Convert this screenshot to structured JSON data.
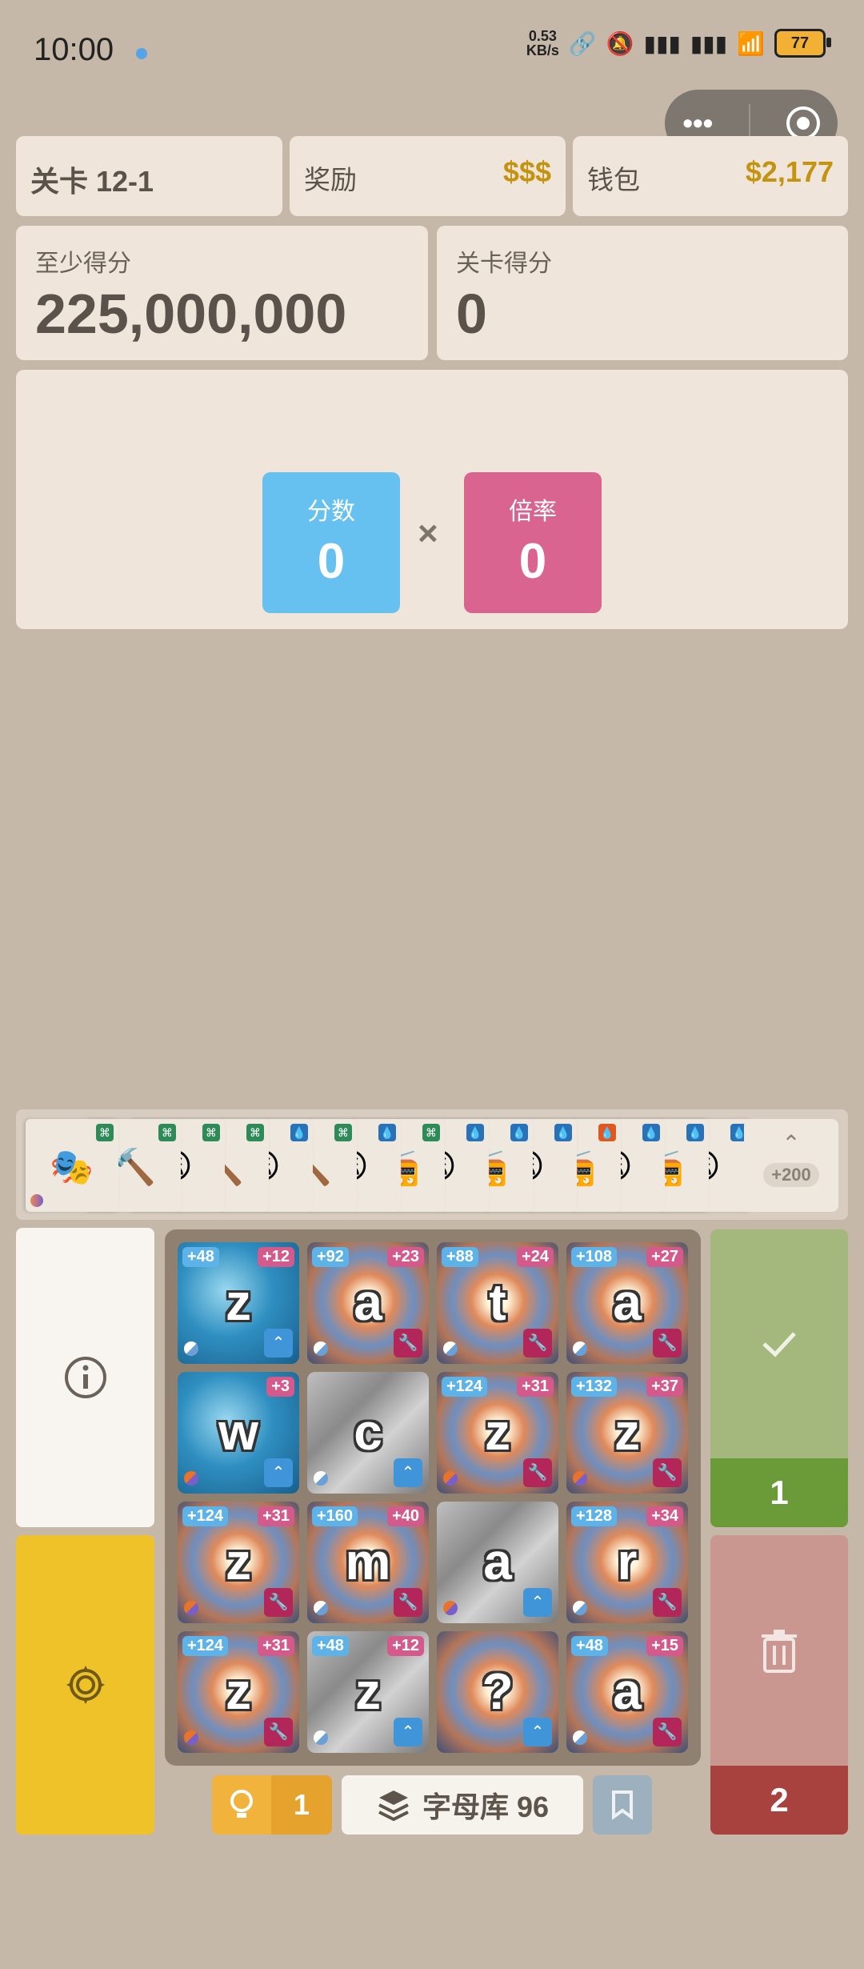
{
  "status": {
    "time": "10:00",
    "net_speed": "0.53",
    "net_unit": "KB/s",
    "battery": "77"
  },
  "header": {
    "level_label": "关卡 12-1",
    "reward_label": "奖励",
    "reward_value": "$$$",
    "wallet_label": "钱包",
    "wallet_value": "$2,177",
    "need_label": "至少得分",
    "need_value": "225,000,000",
    "level_score_label": "关卡得分",
    "level_score_value": "0"
  },
  "scoring": {
    "score_label": "分数",
    "score_value": "0",
    "times": "×",
    "mult_label": "倍率",
    "mult_value": "0"
  },
  "tray": {
    "upgrade_badge": "+200"
  },
  "tiles": [
    {
      "letter": "z",
      "left": "+48",
      "right": "+12",
      "bg": "water",
      "effect": "up",
      "dot": "white"
    },
    {
      "letter": "a",
      "left": "+92",
      "right": "+23",
      "bg": "burst",
      "effect": "tool",
      "dot": "white"
    },
    {
      "letter": "t",
      "left": "+88",
      "right": "+24",
      "bg": "burst",
      "effect": "tool",
      "dot": "white"
    },
    {
      "letter": "a",
      "left": "+108",
      "right": "+27",
      "bg": "burst",
      "effect": "tool",
      "dot": "white"
    },
    {
      "letter": "w",
      "left": "",
      "right": "+3",
      "bg": "water",
      "effect": "up",
      "dot": "multi"
    },
    {
      "letter": "c",
      "left": "",
      "right": "",
      "bg": "steel",
      "effect": "up",
      "dot": "white"
    },
    {
      "letter": "z",
      "left": "+124",
      "right": "+31",
      "bg": "burst",
      "effect": "tool",
      "dot": "multi"
    },
    {
      "letter": "z",
      "left": "+132",
      "right": "+37",
      "bg": "burst",
      "effect": "tool",
      "dot": "multi"
    },
    {
      "letter": "z",
      "left": "+124",
      "right": "+31",
      "bg": "burst",
      "effect": "tool",
      "dot": "multi"
    },
    {
      "letter": "m",
      "left": "+160",
      "right": "+40",
      "bg": "burst",
      "effect": "tool",
      "dot": "white"
    },
    {
      "letter": "a",
      "left": "",
      "right": "",
      "bg": "steel",
      "effect": "up",
      "dot": "multi"
    },
    {
      "letter": "r",
      "left": "+128",
      "right": "+34",
      "bg": "burst",
      "effect": "tool",
      "dot": "white"
    },
    {
      "letter": "z",
      "left": "+124",
      "right": "+31",
      "bg": "burst",
      "effect": "tool",
      "dot": "multi"
    },
    {
      "letter": "z",
      "left": "+48",
      "right": "+12",
      "bg": "steel",
      "effect": "up",
      "dot": "white"
    },
    {
      "letter": "?",
      "left": "",
      "right": "",
      "bg": "burst",
      "effect": "up",
      "dot": ""
    },
    {
      "letter": "a",
      "left": "+48",
      "right": "+15",
      "bg": "burst",
      "effect": "tool",
      "dot": "white"
    }
  ],
  "actions": {
    "confirm_count": "1",
    "discard_count": "2",
    "hint_count": "1",
    "library_label": "字母库 96"
  },
  "colors": {
    "background": "#c5b8a8",
    "score": "#66c0f0",
    "mult": "#d8648f",
    "confirm": "#6b9a38",
    "discard": "#a7423f",
    "settings": "#f0c22a"
  }
}
